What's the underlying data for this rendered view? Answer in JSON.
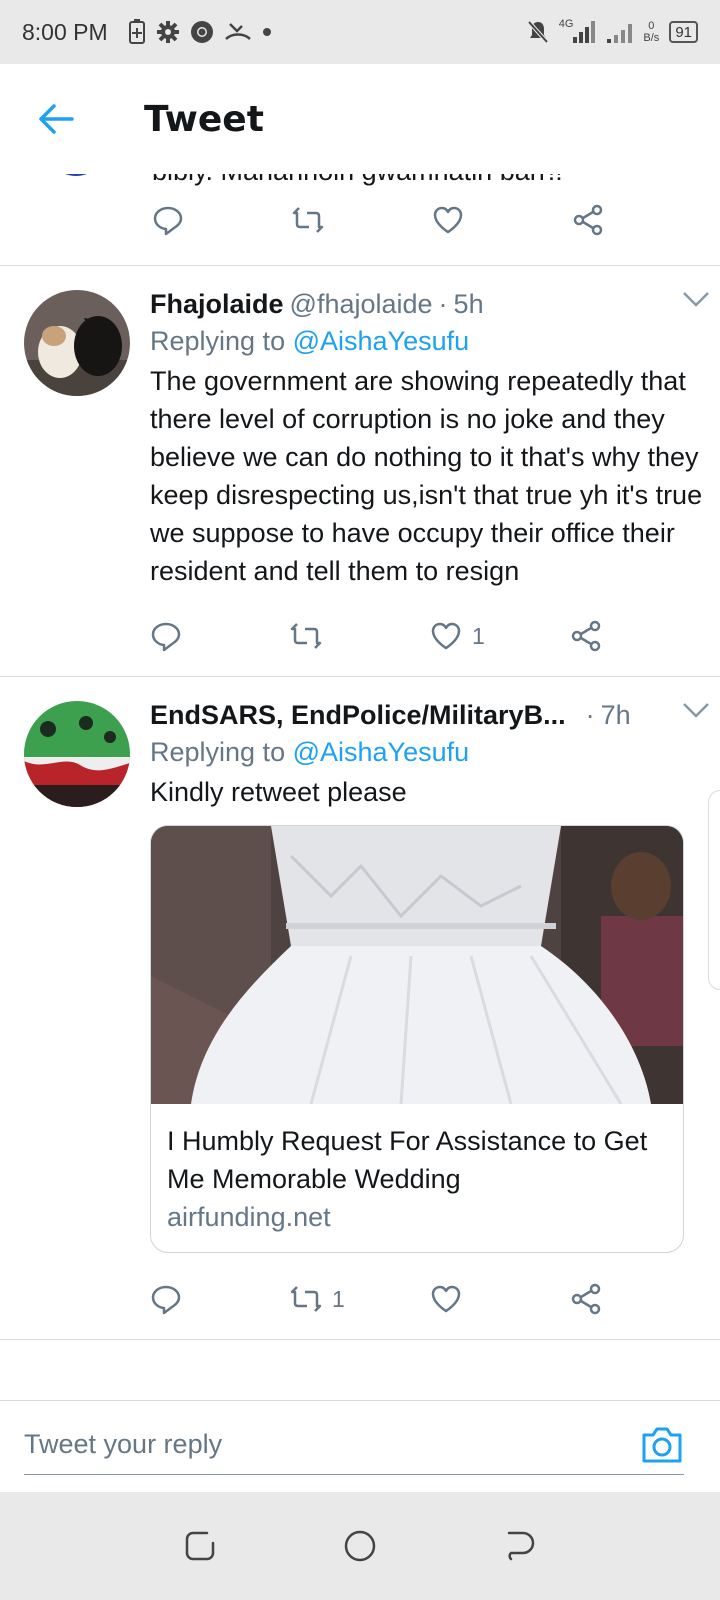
{
  "status_bar": {
    "time": "8:00 PM",
    "network_type": "4G",
    "data_rate_value": "0",
    "data_rate_unit": "B/s",
    "battery": "91"
  },
  "header": {
    "title": "Tweet"
  },
  "partial_tweet": {
    "text": "bibly. Manahnoin gwamnatin barr!!"
  },
  "tweets": [
    {
      "name": "Fhajolaide",
      "handle": "@fhajolaide",
      "time": "5h",
      "replying_prefix": "Replying to",
      "replying_to": "@AishaYesufu",
      "text": "The government are showing repeatedly that there level of corruption is no joke and they believe we can do nothing to it that's why they keep disrespecting us,isn't that true yh it's true we suppose to have occupy their office their resident and tell them to resign",
      "likes": "1"
    },
    {
      "name": "EndSARS, EndPolice/MilitaryB...",
      "handle": "",
      "time": "7h",
      "replying_prefix": "Replying to",
      "replying_to": "@AishaYesufu",
      "text": "Kindly retweet please",
      "card_title": "I Humbly Request For Assistance to Get Me Memorable Wedding",
      "card_domain": "airfunding.net",
      "retweets": "1"
    }
  ],
  "reply": {
    "placeholder": "Tweet your reply"
  },
  "colors": {
    "accent": "#1da1f2",
    "secondary_text": "#657786"
  }
}
